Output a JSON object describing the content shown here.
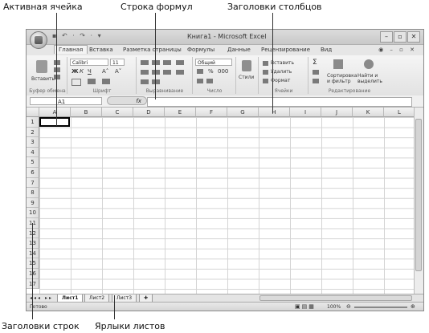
{
  "callouts": {
    "active_cell": "Активная ячейка",
    "formula_bar": "Строка формул",
    "column_headers": "Заголовки столбцов",
    "row_headers": "Заголовки строк",
    "sheet_tabs": "Ярлыки листов"
  },
  "window": {
    "title": "Книга1 - Microsoft Excel",
    "qat": "▪ ↶ · ↷ · ▾"
  },
  "tabs": [
    "Главная",
    "Вставка",
    "Разметка страницы",
    "Формулы",
    "Данные",
    "Рецензирование",
    "Вид"
  ],
  "ribbon": {
    "clipboard": {
      "paste": "Вставить",
      "caption": "Буфер обмена"
    },
    "font": {
      "name": "Calibri",
      "size": "11",
      "bold": "Ж",
      "italic": "К",
      "underline": "Ч",
      "grow": "A˄",
      "shrink": "A˅",
      "caption": "Шрифт"
    },
    "alignment": {
      "caption": "Выравнивание"
    },
    "number": {
      "format": "Общий",
      "percent": "%",
      "thousands": "000",
      "caption": "Число"
    },
    "styles": {
      "label": "Стили"
    },
    "cells": {
      "insert": "Вставить",
      "delete": "Удалить",
      "format": "Формат",
      "caption": "Ячейки"
    },
    "editing": {
      "sigma": "Σ",
      "sort": "Сортировка и фильтр",
      "find": "Найти и выделить",
      "caption": "Редактирование"
    }
  },
  "formula_bar": {
    "name_box": "A1",
    "fx": "fx",
    "value": ""
  },
  "columns": [
    "A",
    "B",
    "C",
    "D",
    "E",
    "F",
    "G",
    "H",
    "I",
    "J",
    "K",
    "L"
  ],
  "rows": [
    "1",
    "2",
    "3",
    "4",
    "5",
    "6",
    "7",
    "8",
    "9",
    "10",
    "11",
    "12",
    "13",
    "14",
    "15",
    "16",
    "17"
  ],
  "sheets": [
    "Лист1",
    "Лист2",
    "Лист3"
  ],
  "status": {
    "ready": "Готово",
    "zoom": "100%"
  }
}
